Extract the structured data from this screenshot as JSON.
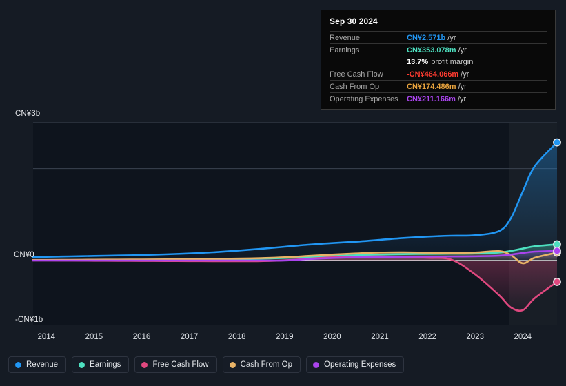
{
  "background": "#151b24",
  "tooltip": {
    "date": "Sep 30 2024",
    "rows": [
      {
        "label": "Revenue",
        "value": "CN¥2.571b",
        "unit": "/yr",
        "color": "#2196f3"
      },
      {
        "label": "Earnings",
        "value": "CN¥353.078m",
        "unit": "/yr",
        "color": "#4de0c0"
      },
      {
        "label": "Free Cash Flow",
        "value": "-CN¥464.066m",
        "unit": "/yr",
        "color": "#ff3b30"
      },
      {
        "label": "Cash From Op",
        "value": "CN¥174.486m",
        "unit": "/yr",
        "color": "#e8a33d"
      },
      {
        "label": "Operating Expenses",
        "value": "CN¥211.166m",
        "unit": "/yr",
        "color": "#aa44ee"
      }
    ],
    "profit_margin_value": "13.7%",
    "profit_margin_note": "profit margin"
  },
  "axis": {
    "y_top": "CN¥3b",
    "y_zero": "CN¥0",
    "y_bottom": "-CN¥1b"
  },
  "legend": {
    "items": [
      {
        "label": "Revenue",
        "color": "#2196f3"
      },
      {
        "label": "Earnings",
        "color": "#4de0c0"
      },
      {
        "label": "Free Cash Flow",
        "color": "#e0487f"
      },
      {
        "label": "Cash From Op",
        "color": "#e8b366"
      },
      {
        "label": "Operating Expenses",
        "color": "#aa44ee"
      }
    ]
  },
  "chart_data": {
    "type": "area",
    "title": "",
    "xlabel": "",
    "ylabel": "CN¥",
    "ylim": [
      -1.0,
      3.0
    ],
    "y_ticks": [
      3,
      2,
      1,
      0,
      -1
    ],
    "y_tick_labels": [
      "CN¥3b",
      "",
      "",
      "CN¥0",
      "-CN¥1b"
    ],
    "grid": true,
    "legend_position": "bottom",
    "highlight_band": {
      "from": 2023.72,
      "to": 2024.72,
      "label": "forecast-or-latest-period"
    },
    "x_tick_labels": [
      "2014",
      "2015",
      "2016",
      "2017",
      "2018",
      "2019",
      "2020",
      "2021",
      "2022",
      "2023",
      "2024"
    ],
    "x": [
      2013.72,
      2014.0,
      2014.5,
      2015.0,
      2015.5,
      2016.0,
      2016.5,
      2017.0,
      2017.5,
      2018.0,
      2018.5,
      2019.0,
      2019.5,
      2020.0,
      2020.5,
      2021.0,
      2021.5,
      2022.0,
      2022.5,
      2023.0,
      2023.5,
      2023.75,
      2024.0,
      2024.25,
      2024.72
    ],
    "series": [
      {
        "name": "Revenue",
        "color": "#2196f3",
        "values": [
          0.075,
          0.08,
          0.09,
          0.1,
          0.11,
          0.12,
          0.135,
          0.155,
          0.18,
          0.215,
          0.255,
          0.3,
          0.345,
          0.38,
          0.41,
          0.45,
          0.49,
          0.52,
          0.54,
          0.55,
          0.64,
          0.92,
          1.5,
          2.05,
          2.571
        ],
        "end_label": "CN¥2.571b"
      },
      {
        "name": "Earnings",
        "color": "#4de0c0",
        "values": [
          0.008,
          0.009,
          0.01,
          0.012,
          0.013,
          0.015,
          0.018,
          0.02,
          0.024,
          0.03,
          0.04,
          0.055,
          0.075,
          0.095,
          0.115,
          0.13,
          0.14,
          0.145,
          0.15,
          0.155,
          0.175,
          0.21,
          0.26,
          0.31,
          0.353
        ],
        "end_label": "CN¥353.078m"
      },
      {
        "name": "Free Cash Flow",
        "color": "#e0487f",
        "values": [
          0.0,
          0.0,
          -0.002,
          -0.004,
          -0.006,
          -0.008,
          -0.01,
          -0.012,
          -0.014,
          -0.015,
          -0.012,
          0.005,
          0.04,
          0.07,
          0.085,
          0.09,
          0.08,
          0.06,
          0.02,
          -0.3,
          -0.75,
          -1.02,
          -1.08,
          -0.82,
          -0.464
        ],
        "end_label": "-CN¥464.066m"
      },
      {
        "name": "Cash From Op",
        "color": "#e8b366",
        "values": [
          0.012,
          0.013,
          0.015,
          0.018,
          0.02,
          0.022,
          0.026,
          0.03,
          0.036,
          0.042,
          0.052,
          0.07,
          0.1,
          0.13,
          0.155,
          0.175,
          0.18,
          0.172,
          0.168,
          0.175,
          0.205,
          0.12,
          -0.06,
          0.06,
          0.174
        ],
        "end_label": "CN¥174.486m"
      },
      {
        "name": "Operating Expenses",
        "color": "#aa44ee",
        "values": [
          0.0,
          0.0,
          0.0,
          0.0,
          0.0,
          0.0,
          0.0,
          0.0,
          0.0,
          0.0,
          0.0,
          0.0,
          0.03,
          0.055,
          0.07,
          0.078,
          0.082,
          0.085,
          0.088,
          0.092,
          0.105,
          0.13,
          0.165,
          0.195,
          0.211
        ],
        "end_label": "CN¥211.166m"
      }
    ]
  }
}
